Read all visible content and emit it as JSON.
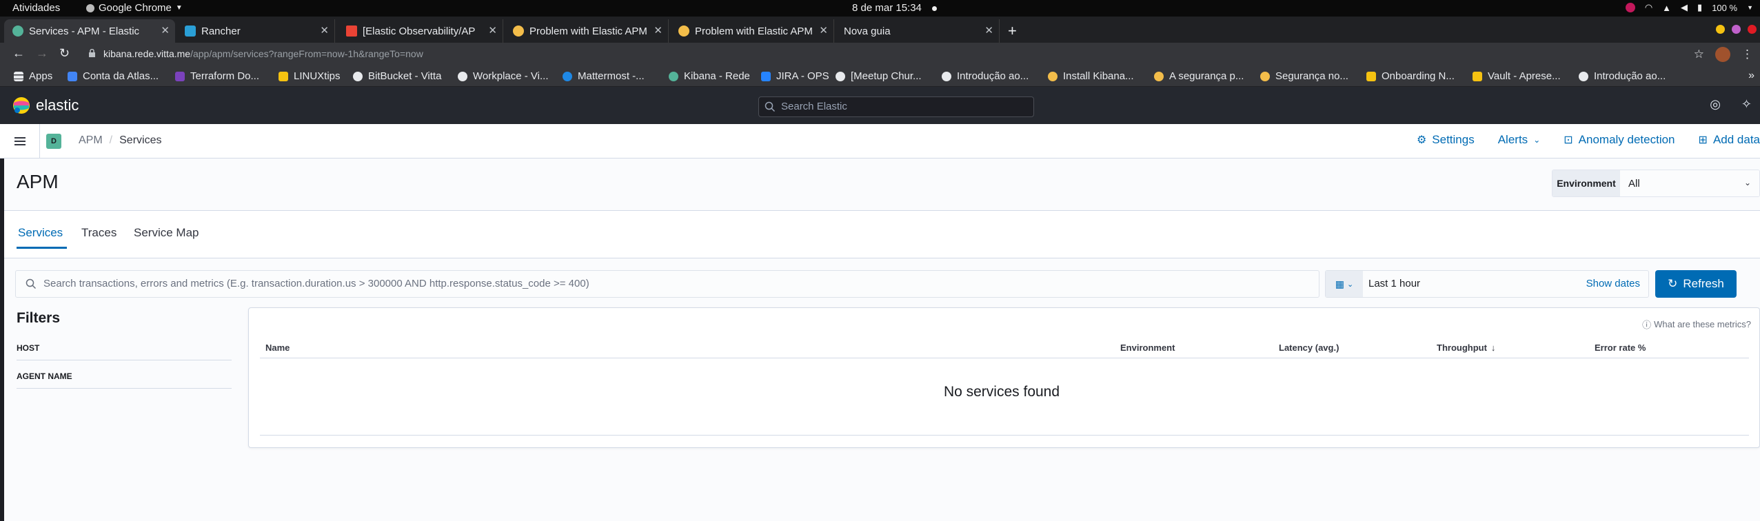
{
  "os": {
    "activities": "Atividades",
    "app_name": "Google Chrome",
    "clock": "8 de mar  15:34",
    "battery": "100 %"
  },
  "browser": {
    "tabs": [
      {
        "label": "Services - APM - Elastic"
      },
      {
        "label": "Rancher"
      },
      {
        "label": "[Elastic Observability/AP"
      },
      {
        "label": "Problem with Elastic APM"
      },
      {
        "label": "Problem with Elastic APM"
      },
      {
        "label": "Nova guia"
      }
    ],
    "url_host": "kibana.rede.vitta.me",
    "url_path": "/app/apm/services?rangeFrom=now-1h&rangeTo=now",
    "bookmarks": [
      {
        "label": "Apps"
      },
      {
        "label": "Conta da Atlas..."
      },
      {
        "label": "Terraform Do..."
      },
      {
        "label": "LINUXtips"
      },
      {
        "label": "BitBucket - Vitta"
      },
      {
        "label": "Workplace - Vi..."
      },
      {
        "label": "Mattermost -..."
      },
      {
        "label": "Kibana - Rede"
      },
      {
        "label": "JIRA - OPS"
      },
      {
        "label": "[Meetup Chur..."
      },
      {
        "label": "Introdução ao..."
      },
      {
        "label": "Install Kibana..."
      },
      {
        "label": "A segurança p..."
      },
      {
        "label": "Segurança no..."
      },
      {
        "label": "Onboarding N..."
      },
      {
        "label": "Vault - Aprese..."
      },
      {
        "label": "Introdução ao..."
      }
    ]
  },
  "kibana": {
    "brand": "elastic",
    "search_placeholder": "Search Elastic",
    "space_initial": "D",
    "breadcrumbs": [
      "APM",
      "Services"
    ],
    "header_links": {
      "settings": "Settings",
      "alerts": "Alerts",
      "anomaly": "Anomaly detection",
      "add_data": "Add data"
    }
  },
  "apm": {
    "title": "APM",
    "environment_label": "Environment",
    "environment_value": "All",
    "tabs": [
      "Services",
      "Traces",
      "Service Map"
    ],
    "query_placeholder": "Search transactions, errors and metrics (E.g. transaction.duration.us > 300000 AND http.response.status_code >= 400)",
    "date_range": "Last 1 hour",
    "show_dates": "Show dates",
    "refresh": "Refresh",
    "filters_title": "Filters",
    "filters": [
      "HOST",
      "AGENT NAME"
    ],
    "metrics_help": "What are these metrics?",
    "columns": [
      "Name",
      "Environment",
      "Latency (avg.)",
      "Throughput",
      "Error rate %"
    ],
    "empty_message": "No services found"
  }
}
